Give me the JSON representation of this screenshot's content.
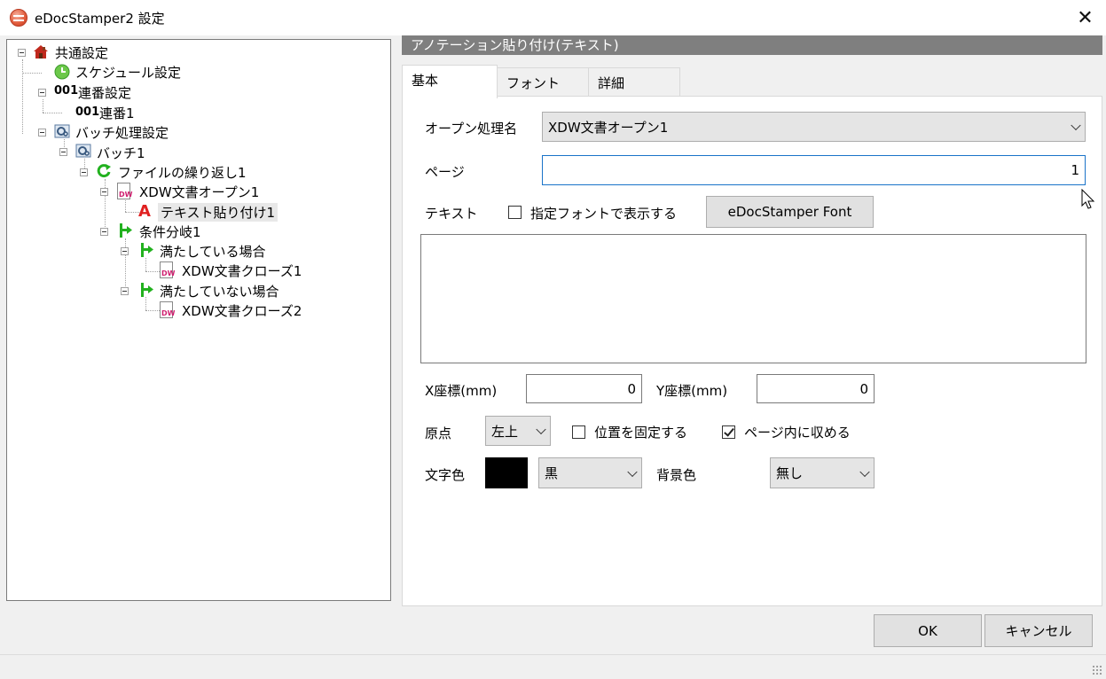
{
  "window": {
    "title": "eDocStamper2 設定",
    "close_glyph": "✕"
  },
  "tree": {
    "items": [
      {
        "label": "共通設定",
        "icon": "house-icon"
      },
      {
        "label": "スケジュール設定",
        "icon": "clock-icon"
      },
      {
        "label": "連番設定",
        "icon": "serial-number-icon",
        "prefix": "001"
      },
      {
        "label": "連番1",
        "icon": "serial-number-icon",
        "prefix": "001"
      },
      {
        "label": "バッチ処理設定",
        "icon": "batch-gear-icon"
      },
      {
        "label": "バッチ1",
        "icon": "batch-gear-icon"
      },
      {
        "label": "ファイルの繰り返し1",
        "icon": "loop-arrow-icon"
      },
      {
        "label": "XDW文書オープン1",
        "icon": "docuworks-document-icon",
        "doc_badge": "DW"
      },
      {
        "label": "テキスト貼り付け1",
        "icon": "text-a-icon",
        "glyph": "A",
        "selected": true
      },
      {
        "label": "条件分岐1",
        "icon": "branch-icon"
      },
      {
        "label": "満たしている場合",
        "icon": "branch-icon"
      },
      {
        "label": "XDW文書クローズ1",
        "icon": "docuworks-document-icon",
        "doc_badge": "DW"
      },
      {
        "label": "満たしていない場合",
        "icon": "branch-icon"
      },
      {
        "label": "XDW文書クローズ2",
        "icon": "docuworks-document-icon",
        "doc_badge": "DW"
      }
    ]
  },
  "panel": {
    "header": "アノテーション貼り付け(テキスト)",
    "tabs": [
      {
        "label": "基本",
        "active": true
      },
      {
        "label": "フォント",
        "active": false
      },
      {
        "label": "詳細",
        "active": false
      }
    ]
  },
  "form": {
    "open_process_label": "オープン処理名",
    "open_process_value": "XDW文書オープン1",
    "page_label": "ページ",
    "page_value": "1",
    "text_label": "テキスト",
    "use_font_label": "指定フォントで表示する",
    "use_font_checked": false,
    "font_button": "eDocStamper Font",
    "text_value": "",
    "x_label": "X座標(mm)",
    "x_value": "0",
    "y_label": "Y座標(mm)",
    "y_value": "0",
    "origin_label": "原点",
    "origin_value": "左上",
    "fix_position_label": "位置を固定する",
    "fix_position_checked": false,
    "fit_page_label": "ページ内に収める",
    "fit_page_checked": true,
    "text_color_label": "文字色",
    "text_color_value": "黒",
    "text_color_swatch": "#000000",
    "bg_color_label": "背景色",
    "bg_color_value": "無し"
  },
  "footer": {
    "ok": "OK",
    "cancel": "キャンセル"
  },
  "colors": {
    "header_bg": "#7f7f7f",
    "branch_green": "#22b11f",
    "text_red": "#e02020"
  }
}
